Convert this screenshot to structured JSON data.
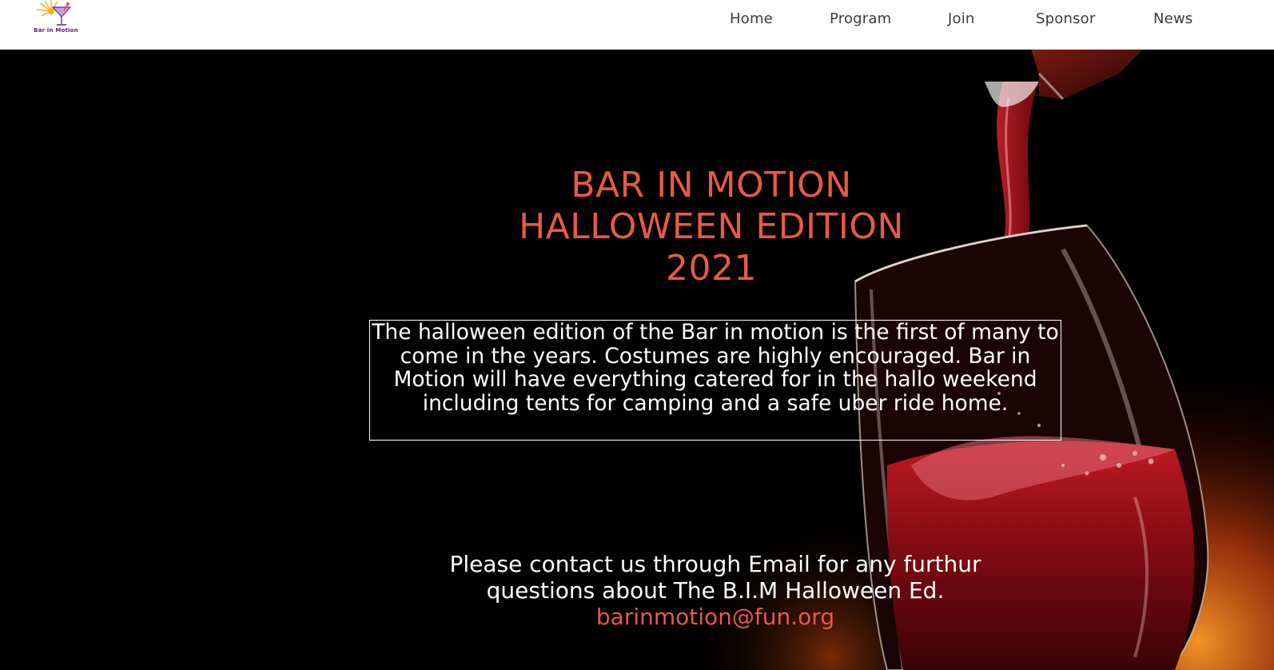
{
  "brand": {
    "logo_text": "Bar in Motion"
  },
  "nav": [
    {
      "label": "Home"
    },
    {
      "label": "Program"
    },
    {
      "label": "Join"
    },
    {
      "label": "Sponsor"
    },
    {
      "label": "News"
    }
  ],
  "hero": {
    "title_lines": [
      "BAR IN MOTION",
      "HALLOWEEN EDITION",
      "2021"
    ],
    "description": "The halloween edition of the Bar in motion is the first of many to come in the years. Costumes are highly encouraged. Bar in Motion will have everything catered for in the hallo weekend including tents for camping and a safe uber ride home.",
    "contact_lines": [
      "Please contact us through Email for any furthur",
      "questions about The B.I.M Halloween Ed."
    ],
    "email": "barinmotion@fun.org"
  },
  "colors": {
    "accent": "#e85a45",
    "hero_background": "#000000",
    "nav_text": "#3a3a3a",
    "wine": "#8b0a14"
  }
}
